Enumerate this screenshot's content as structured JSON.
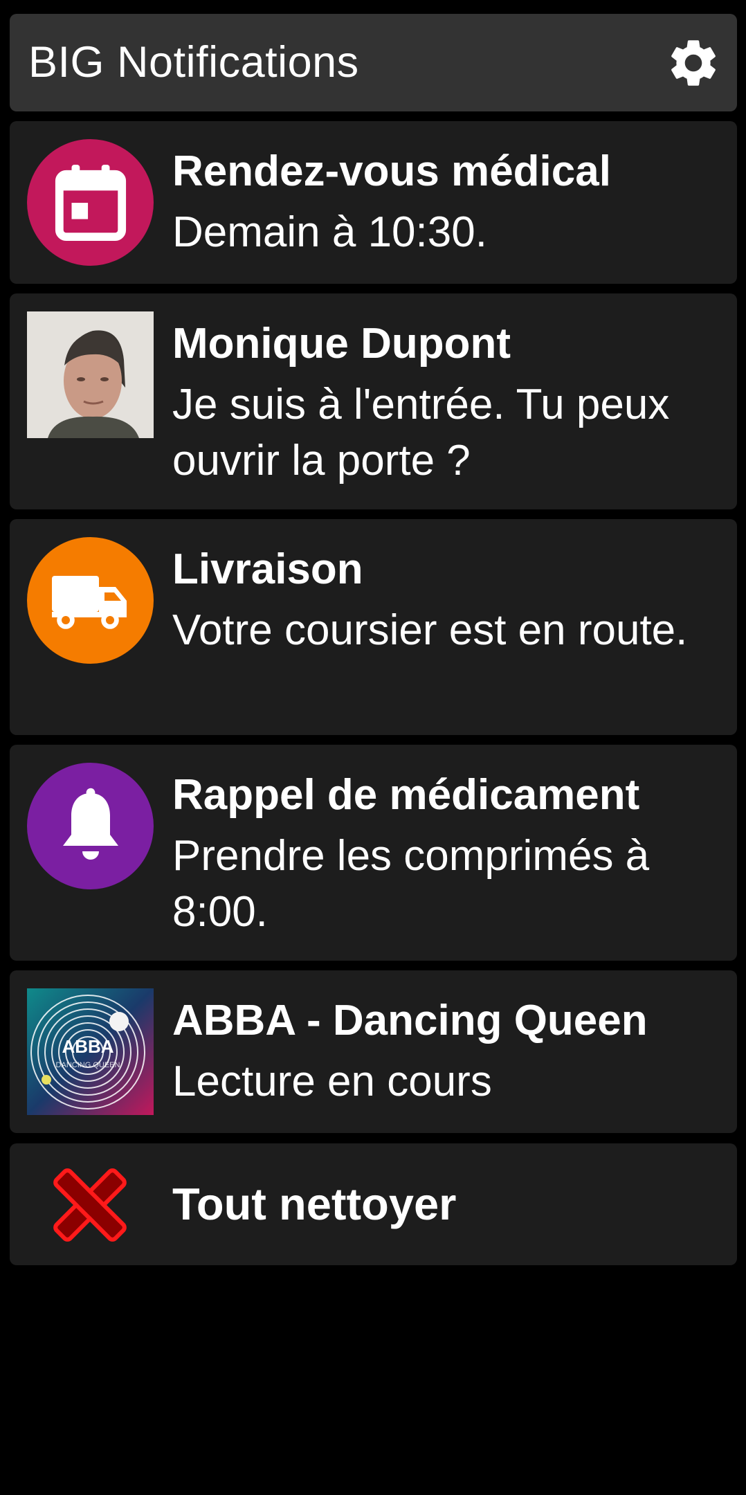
{
  "app": {
    "title": "BIG Notifications"
  },
  "icons": {
    "settings": "gear-icon",
    "calendar": "calendar-icon",
    "truck": "truck-icon",
    "bell": "bell-icon",
    "clear": "close-icon"
  },
  "colors": {
    "calendar": "#c2185b",
    "delivery": "#f57c00",
    "medication": "#7b1fa2",
    "clear": "#ff1a1a"
  },
  "notifications": [
    {
      "title": "Rendez-vous médical",
      "body": "Demain à 10:30."
    },
    {
      "title": "Monique Dupont",
      "body": "Je suis à l'entrée. Tu peux ouvrir la porte ?"
    },
    {
      "title": "Livraison",
      "body": "Votre coursier est en route."
    },
    {
      "title": "Rappel de médicament",
      "body": "Prendre les comprimés à 8:00."
    },
    {
      "title": "ABBA - Dancing Queen",
      "body": "Lecture en cours",
      "album_text": "ABBA",
      "album_subtext": "DANCING QUEEN"
    }
  ],
  "clear_all": {
    "label": "Tout nettoyer"
  }
}
